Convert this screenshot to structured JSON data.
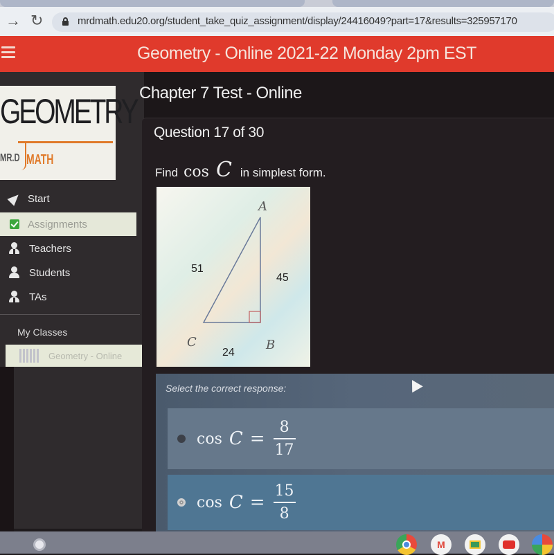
{
  "browser": {
    "url": "mrdmath.edu20.org/student_take_quiz_assignment/display/24416049?part=17&results=325957170",
    "back_icon": "arrow-right-icon",
    "reload_icon": "reload-icon",
    "lock_icon": "lock-icon"
  },
  "header": {
    "title": "Geometry - Online 2021-22 Monday 2pm EST",
    "menu_icon": "hamburger-icon",
    "color": "#e03a2c"
  },
  "logo": {
    "main": "GEOMETRY",
    "sub_left": "MR.D",
    "sub_right": "MATH"
  },
  "sidebar": {
    "items": [
      {
        "label": "Start",
        "icon": "navigation-arrow-icon",
        "active": false
      },
      {
        "label": "Assignments",
        "icon": "checkbox-icon",
        "active": true
      },
      {
        "label": "Teachers",
        "icon": "person-icon",
        "active": false
      },
      {
        "label": "Students",
        "icon": "person-icon",
        "active": false
      },
      {
        "label": "TAs",
        "icon": "person-icon",
        "active": false
      }
    ],
    "section_label": "My Classes",
    "classes": [
      {
        "label": "Geometry - Online"
      }
    ]
  },
  "main": {
    "chapter_title": "Chapter 7 Test - Online",
    "question_number": "Question 17 of 30",
    "prompt": {
      "before": "Find",
      "function": "cos",
      "variable": "C",
      "after": "in simplest form."
    },
    "figure": {
      "vertices": {
        "A": "A",
        "B": "B",
        "C": "C"
      },
      "sides": {
        "AC": "51",
        "AB": "45",
        "CB": "24"
      },
      "right_angle_at": "B"
    },
    "select_label": "Select the correct response:",
    "options": [
      {
        "function": "cos",
        "variable": "C",
        "equals": "=",
        "numerator": "8",
        "denominator": "17",
        "selected": true
      },
      {
        "function": "cos",
        "variable": "C",
        "equals": "=",
        "numerator": "15",
        "denominator": "8",
        "selected": false
      }
    ]
  },
  "taskbar": {
    "launcher_icon": "launcher-icon",
    "apps": [
      "chrome-icon",
      "gmail-icon",
      "classroom-icon",
      "youtube-icon",
      "photos-icon"
    ]
  }
}
